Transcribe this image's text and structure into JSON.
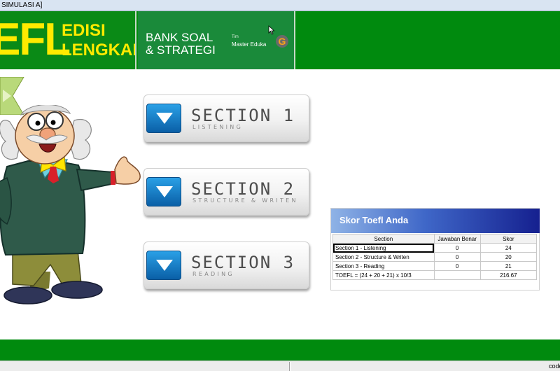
{
  "window": {
    "title": "SIMULASI A]"
  },
  "header": {
    "brand_efl": "EFL",
    "brand_edisi": "EDISI",
    "brand_lengkap": "LENGKAP",
    "bank_line1": "BANK SOAL",
    "bank_line2": "& STRATEGI",
    "tim": "Tim",
    "master": "Master Eduka",
    "logo_letter": "G"
  },
  "sections": [
    {
      "title": "SECTION 1",
      "subtitle": "LISTENING"
    },
    {
      "title": "SECTION 2",
      "subtitle": "STRUCTURE & WRITEN"
    },
    {
      "title": "SECTION 3",
      "subtitle": "READING"
    }
  ],
  "score": {
    "title": "Skor Toefl Anda",
    "columns": [
      "Section",
      "Jawaban Benar",
      "Skor"
    ],
    "rows": [
      [
        "Section 1 - Listening",
        "0",
        "24"
      ],
      [
        "Section 2 - Structure & Writen",
        "0",
        "20"
      ],
      [
        "Section 3 - Reading",
        "0",
        "21"
      ],
      [
        "TOEFL = (24 + 20 + 21) x 10/3",
        "",
        "216.67"
      ]
    ]
  },
  "statusbar": {
    "text": "code"
  },
  "colors": {
    "header_green": "#008a0e",
    "brand_yellow": "#ffea00",
    "panel_blue": "#15208f"
  }
}
